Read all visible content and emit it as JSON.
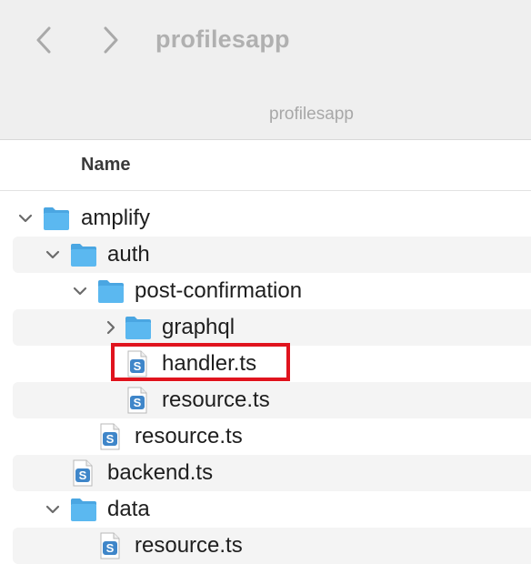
{
  "window": {
    "title": "profilesapp",
    "path_label": "profilesapp"
  },
  "toolbar": {
    "back_icon": "chevron-left-icon",
    "forward_icon": "chevron-right-icon"
  },
  "column_header": {
    "name": "Name"
  },
  "rows": [
    {
      "label": "amplify",
      "kind": "folder",
      "depth": 0,
      "disclosure": "expanded"
    },
    {
      "label": "auth",
      "kind": "folder",
      "depth": 1,
      "disclosure": "expanded"
    },
    {
      "label": "post-confirmation",
      "kind": "folder",
      "depth": 2,
      "disclosure": "expanded"
    },
    {
      "label": "graphql",
      "kind": "folder",
      "depth": 3,
      "disclosure": "collapsed"
    },
    {
      "label": "handler.ts",
      "kind": "ts-file",
      "depth": 3,
      "highlighted": true
    },
    {
      "label": "resource.ts",
      "kind": "ts-file",
      "depth": 3
    },
    {
      "label": "resource.ts",
      "kind": "ts-file",
      "depth": 2
    },
    {
      "label": "backend.ts",
      "kind": "ts-file",
      "depth": 1
    },
    {
      "label": "data",
      "kind": "folder",
      "depth": 1,
      "disclosure": "expanded"
    },
    {
      "label": "resource.ts",
      "kind": "ts-file",
      "depth": 2
    }
  ],
  "colors": {
    "folder": "#5bb8f0",
    "folder_tab": "#4aa6e2",
    "ts_icon": "#3f86c9",
    "highlight": "#e0141e",
    "alt_row": "#f4f4f4"
  }
}
